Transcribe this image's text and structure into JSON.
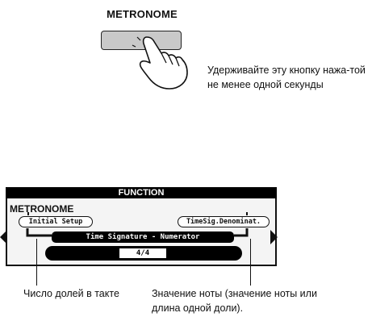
{
  "button": {
    "label": "METRONOME",
    "instruction": "Удерживайте эту кнопку нажа-той не менее одной секунды"
  },
  "display": {
    "header": "FUNCTION",
    "title": "METRONOME",
    "left_item": "Initial Setup",
    "right_item": "TimeSig.Denominat.",
    "parameter": "Time Signature - Numerator",
    "value": "4/4"
  },
  "callouts": {
    "beats": "Число долей в такте",
    "note_value": "Значение ноты (значение ноты или длина одной доли)."
  },
  "icons": {
    "hand": "pointing-hand-icon",
    "left": "triangle-left-icon",
    "right": "triangle-right-icon"
  }
}
